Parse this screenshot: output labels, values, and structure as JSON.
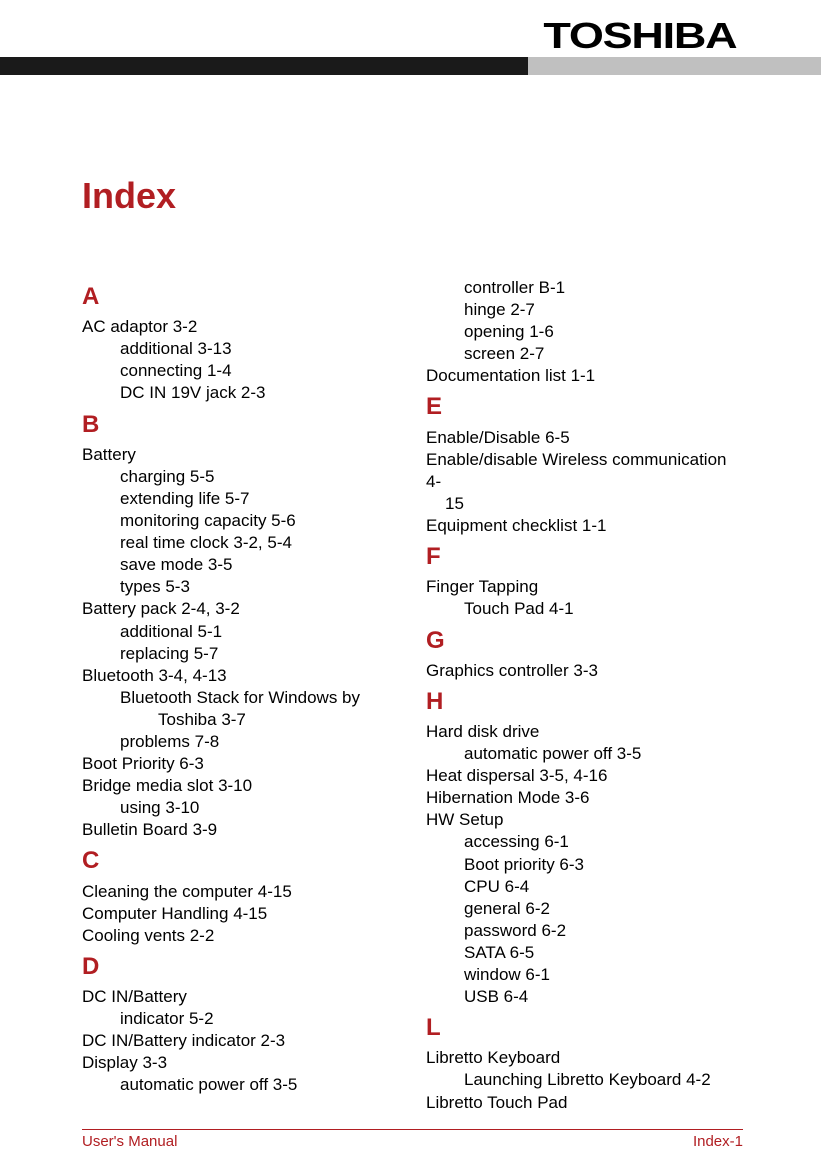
{
  "brand": "TOSHIBA",
  "page_title": "Index",
  "footer": {
    "left": "User's Manual",
    "right": "Index-1"
  },
  "col1": [
    {
      "cls": "letter",
      "t": "A"
    },
    {
      "cls": "entry",
      "t": "AC adaptor 3-2"
    },
    {
      "cls": "sub",
      "t": "additional 3-13"
    },
    {
      "cls": "sub",
      "t": "connecting 1-4"
    },
    {
      "cls": "sub",
      "t": "DC IN 19V jack 2-3"
    },
    {
      "cls": "letter",
      "t": "B"
    },
    {
      "cls": "entry",
      "t": "Battery"
    },
    {
      "cls": "sub",
      "t": "charging 5-5"
    },
    {
      "cls": "sub",
      "t": "extending life 5-7"
    },
    {
      "cls": "sub",
      "t": "monitoring capacity 5-6"
    },
    {
      "cls": "sub",
      "t": "real time clock 3-2, 5-4"
    },
    {
      "cls": "sub",
      "t": "save mode 3-5"
    },
    {
      "cls": "sub",
      "t": "types 5-3"
    },
    {
      "cls": "entry",
      "t": "Battery pack 2-4, 3-2"
    },
    {
      "cls": "sub",
      "t": "additional 5-1"
    },
    {
      "cls": "sub",
      "t": "replacing 5-7"
    },
    {
      "cls": "entry",
      "t": "Bluetooth 3-4, 4-13"
    },
    {
      "cls": "sub",
      "t": "Bluetooth Stack for Windows by"
    },
    {
      "cls": "subsub",
      "t": "Toshiba 3-7"
    },
    {
      "cls": "sub",
      "t": "problems 7-8"
    },
    {
      "cls": "entry",
      "t": "Boot Priority 6-3"
    },
    {
      "cls": "entry",
      "t": "Bridge media slot 3-10"
    },
    {
      "cls": "sub",
      "t": "using 3-10"
    },
    {
      "cls": "entry",
      "t": "Bulletin Board 3-9"
    },
    {
      "cls": "letter",
      "t": "C"
    },
    {
      "cls": "entry",
      "t": "Cleaning the computer 4-15"
    },
    {
      "cls": "entry",
      "t": "Computer Handling 4-15"
    },
    {
      "cls": "entry",
      "t": "Cooling vents 2-2"
    },
    {
      "cls": "letter",
      "t": "D"
    },
    {
      "cls": "entry",
      "t": "DC IN/Battery"
    },
    {
      "cls": "sub",
      "t": "indicator 5-2"
    },
    {
      "cls": "entry",
      "t": "DC IN/Battery indicator 2-3"
    },
    {
      "cls": "entry",
      "t": "Display 3-3"
    },
    {
      "cls": "sub",
      "t": "automatic power off 3-5"
    }
  ],
  "col2": [
    {
      "cls": "sub",
      "t": "controller B-1"
    },
    {
      "cls": "sub",
      "t": "hinge 2-7"
    },
    {
      "cls": "sub",
      "t": "opening 1-6"
    },
    {
      "cls": "sub",
      "t": "screen 2-7"
    },
    {
      "cls": "entry",
      "t": "Documentation list 1-1"
    },
    {
      "cls": "letter",
      "t": "E"
    },
    {
      "cls": "entry",
      "t": "Enable/Disable 6-5"
    },
    {
      "cls": "entry",
      "t": "Enable/disable Wireless communication 4-"
    },
    {
      "cls": "cont",
      "t": "15"
    },
    {
      "cls": "entry",
      "t": "Equipment checklist 1-1"
    },
    {
      "cls": "letter",
      "t": "F"
    },
    {
      "cls": "entry",
      "t": "Finger Tapping"
    },
    {
      "cls": "sub",
      "t": "Touch Pad 4-1"
    },
    {
      "cls": "letter",
      "t": "G"
    },
    {
      "cls": "entry",
      "t": "Graphics controller 3-3"
    },
    {
      "cls": "letter",
      "t": "H"
    },
    {
      "cls": "entry",
      "t": "Hard disk drive"
    },
    {
      "cls": "sub",
      "t": "automatic power off 3-5"
    },
    {
      "cls": "entry",
      "t": "Heat dispersal 3-5, 4-16"
    },
    {
      "cls": "entry",
      "t": "Hibernation Mode 3-6"
    },
    {
      "cls": "entry",
      "t": "HW Setup"
    },
    {
      "cls": "sub",
      "t": "accessing 6-1"
    },
    {
      "cls": "sub",
      "t": "Boot priority 6-3"
    },
    {
      "cls": "sub",
      "t": "CPU 6-4"
    },
    {
      "cls": "sub",
      "t": "general 6-2"
    },
    {
      "cls": "sub",
      "t": "password 6-2"
    },
    {
      "cls": "sub",
      "t": "SATA 6-5"
    },
    {
      "cls": "sub",
      "t": "window 6-1"
    },
    {
      "cls": "sub",
      "t": "USB 6-4"
    },
    {
      "cls": "letter",
      "t": "L"
    },
    {
      "cls": "entry",
      "t": "Libretto Keyboard"
    },
    {
      "cls": "sub",
      "t": "Launching Libretto Keyboard 4-2"
    },
    {
      "cls": "entry",
      "t": "Libretto Touch Pad"
    }
  ]
}
